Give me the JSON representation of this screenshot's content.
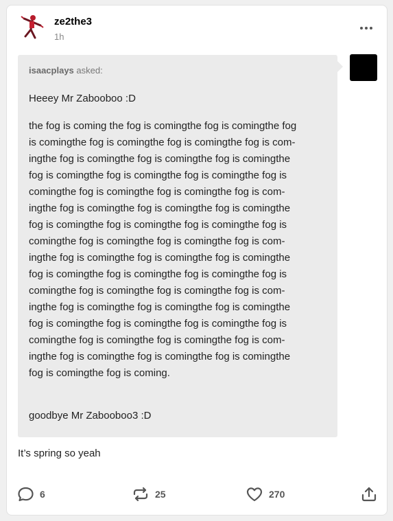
{
  "post": {
    "username": "ze2the3",
    "time": "1h",
    "ask": {
      "asker": "isaacplays",
      "asked_label": "asked:",
      "greeting": "Heeey Mr Zabooboo :D",
      "lines": [
        "the fog is coming the fog is comingthe fog is comingthe fog",
        "is comingthe fog is comingthe fog is comingthe fog is com-",
        "ingthe fog is comingthe fog is comingthe fog is comingthe",
        "fog is comingthe fog is comingthe fog is comingthe fog is",
        "comingthe fog is comingthe fog is comingthe fog is com-",
        "ingthe fog is comingthe fog is comingthe fog is comingthe",
        "fog is comingthe fog is comingthe fog is comingthe fog is",
        "comingthe fog is comingthe fog is comingthe fog is com-",
        "ingthe fog is comingthe fog is comingthe fog is comingthe",
        "fog is comingthe fog is comingthe fog is comingthe fog is",
        "comingthe fog is comingthe fog is comingthe fog is com-",
        "ingthe fog is comingthe fog is comingthe fog is comingthe",
        "fog is comingthe fog is comingthe fog is comingthe fog is",
        "comingthe fog is comingthe fog is comingthe fog is com-",
        "ingthe fog is comingthe fog is comingthe fog is comingthe",
        "fog is comingthe fog is coming."
      ],
      "signoff": "goodbye Mr Zabooboo3 :D"
    },
    "answer": "It’s spring so yeah",
    "footer": {
      "replies_icon": "comment-icon",
      "replies": "6",
      "reblogs_icon": "reblog-icon",
      "reblogs": "25",
      "likes_icon": "heart-icon",
      "likes": "270",
      "share_icon": "share-icon"
    },
    "colors": {
      "ask_background": "#ebebeb",
      "muted_text": "#888888",
      "icon": "#555555"
    }
  }
}
